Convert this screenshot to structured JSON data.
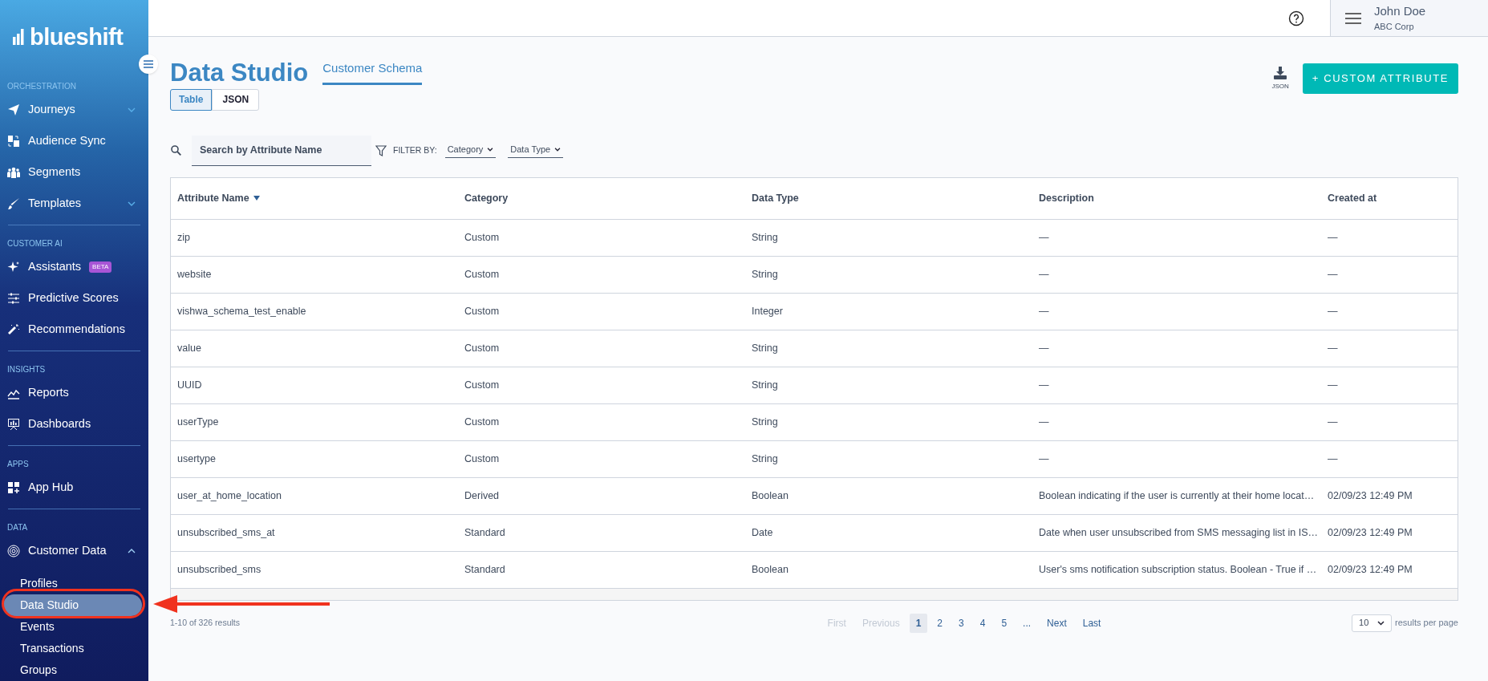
{
  "brand": {
    "logo": "blueshift"
  },
  "topbar": {
    "user_name": "John Doe",
    "org": "ABC Corp"
  },
  "sidebar": {
    "sections": [
      {
        "heading": "ORCHESTRATION",
        "items": [
          {
            "label": "Journeys",
            "expanded": false
          },
          {
            "label": "Audience Sync"
          },
          {
            "label": "Segments"
          },
          {
            "label": "Templates",
            "expanded": false
          }
        ]
      },
      {
        "heading": "CUSTOMER AI",
        "items": [
          {
            "label": "Assistants",
            "badge": "BETA"
          },
          {
            "label": "Predictive Scores"
          },
          {
            "label": "Recommendations"
          }
        ]
      },
      {
        "heading": "INSIGHTS",
        "items": [
          {
            "label": "Reports"
          },
          {
            "label": "Dashboards"
          }
        ]
      },
      {
        "heading": "APPS",
        "items": [
          {
            "label": "App Hub"
          }
        ]
      },
      {
        "heading": "DATA",
        "items": [
          {
            "label": "Customer Data",
            "expanded": true,
            "children": [
              {
                "label": "Profiles",
                "selected": false
              },
              {
                "label": "Data Studio",
                "selected": true
              },
              {
                "label": "Events",
                "selected": false
              },
              {
                "label": "Transactions",
                "selected": false
              },
              {
                "label": "Groups",
                "selected": false
              }
            ]
          }
        ]
      }
    ]
  },
  "page": {
    "title": "Data Studio",
    "tabs": [
      {
        "label": "Customer Schema",
        "selected": true
      }
    ],
    "views": [
      {
        "label": "Table",
        "selected": true
      },
      {
        "label": "JSON",
        "selected": false
      }
    ],
    "download": {
      "label": "JSON"
    },
    "primary_button": "+ CUSTOM ATTRIBUTE",
    "search": {
      "placeholder": "Search by Attribute Name"
    },
    "filter_label": "FILTER BY:",
    "filters": [
      "Category",
      "Data Type"
    ]
  },
  "table": {
    "columns": [
      {
        "label": "Attribute Name",
        "sorted": true
      },
      {
        "label": "Category",
        "sorted": false
      },
      {
        "label": "Data Type",
        "sorted": false
      },
      {
        "label": "Description",
        "sorted": false
      },
      {
        "label": "Created at",
        "sorted": false
      }
    ],
    "rows": [
      [
        "zip",
        "Custom",
        "String",
        "—",
        "—"
      ],
      [
        "website",
        "Custom",
        "String",
        "—",
        "—"
      ],
      [
        "vishwa_schema_test_enable",
        "Custom",
        "Integer",
        "—",
        "—"
      ],
      [
        "value",
        "Custom",
        "String",
        "—",
        "—"
      ],
      [
        "UUID",
        "Custom",
        "String",
        "—",
        "—"
      ],
      [
        "userType",
        "Custom",
        "String",
        "—",
        "—"
      ],
      [
        "usertype",
        "Custom",
        "String",
        "—",
        "—"
      ],
      [
        "user_at_home_location",
        "Derived",
        "Boolean",
        "Boolean indicating if the user is currently at their home locat…",
        "02/09/23 12:49 PM"
      ],
      [
        "unsubscribed_sms_at",
        "Standard",
        "Date",
        "Date when user unsubscribed from SMS messaging list in IS…",
        "02/09/23 12:49 PM"
      ],
      [
        "unsubscribed_sms",
        "Standard",
        "Boolean",
        "User's sms notification subscription status. Boolean - True if …",
        "02/09/23 12:49 PM"
      ]
    ]
  },
  "pagination": {
    "summary": "1-10 of 326 results",
    "pages": [
      {
        "label": "First",
        "selected": false,
        "disabled": true
      },
      {
        "label": "Previous",
        "selected": false,
        "disabled": true
      },
      {
        "label": "1",
        "selected": true,
        "disabled": false
      },
      {
        "label": "2",
        "selected": false,
        "disabled": false
      },
      {
        "label": "3",
        "selected": false,
        "disabled": false
      },
      {
        "label": "4",
        "selected": false,
        "disabled": false
      },
      {
        "label": "5",
        "selected": false,
        "disabled": false
      },
      {
        "label": "...",
        "selected": false,
        "disabled": false
      },
      {
        "label": "Next",
        "selected": false,
        "disabled": false
      },
      {
        "label": "Last",
        "selected": false,
        "disabled": false
      }
    ],
    "per_page": "10",
    "per_page_label": "results per page"
  }
}
